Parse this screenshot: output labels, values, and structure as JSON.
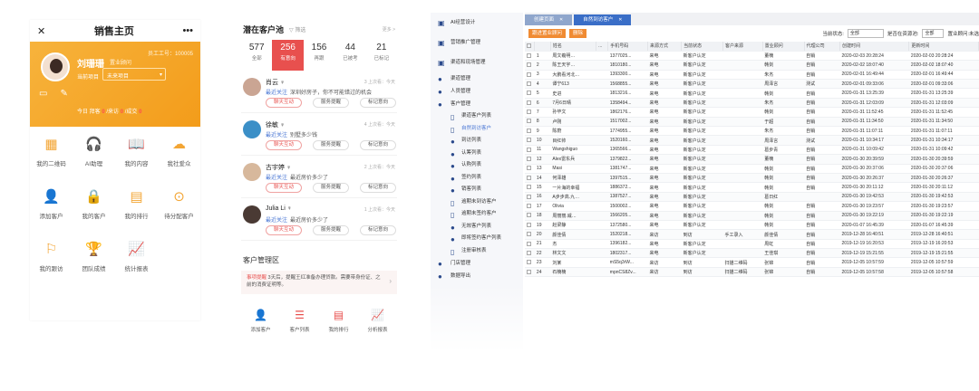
{
  "mobile_home": {
    "close_icon": "close-icon",
    "title": "销售主页",
    "more": "•••",
    "user_name": "刘珊珊",
    "user_role": "置业顾问",
    "emp_no": "员工工号：100005",
    "project_label": "当前项目",
    "project_value": "未来项目",
    "today_prefix": "今日 拜客",
    "today_count_1": "0",
    "today_mid": "/来访",
    "today_count_2": "0",
    "today_suffix": "/成交",
    "today_count_3": "0",
    "menu": [
      {
        "label": "我的二维码",
        "icon": "▦"
      },
      {
        "label": "AI助理",
        "icon": "🎧"
      },
      {
        "label": "我的内容",
        "icon": "📖"
      },
      {
        "label": "我社爱众",
        "icon": "☁"
      },
      {
        "label": "添加客户",
        "icon": "👤"
      },
      {
        "label": "我的客户",
        "icon": "🔒"
      },
      {
        "label": "我的排行",
        "icon": "▤"
      },
      {
        "label": "待分配客户",
        "icon": "⊙"
      },
      {
        "label": "我的跟访",
        "icon": "⚐"
      },
      {
        "label": "团队成绩",
        "icon": "🏆"
      },
      {
        "label": "统计报表",
        "icon": "📈"
      }
    ]
  },
  "pool": {
    "title": "潜在客户池",
    "filter": "筛选",
    "more": "更多 >",
    "stats": [
      {
        "n": "577",
        "l": "全部"
      },
      {
        "n": "256",
        "l": "有意向"
      },
      {
        "n": "156",
        "l": "再跟"
      },
      {
        "n": "44",
        "l": "已被考"
      },
      {
        "n": "21",
        "l": "已标记"
      }
    ],
    "customers": [
      {
        "name": "肖云 ♀",
        "time": "3 上次看：今天",
        "recent": "最近关注",
        "msg": "深圳好房子，你不可能错过的机会",
        "b1": "聊天互动",
        "b2": "服务提醒",
        "b3": "标记意向"
      },
      {
        "name": "徐敏 ♀",
        "time": "4 上次看：今天",
        "recent": "最近关注",
        "msg": "别墅多少钱",
        "b1": "聊天互动",
        "b2": "服务提醒",
        "b3": "标记意向"
      },
      {
        "name": "古宇婷 ♀",
        "time": "2 上次看：今天",
        "recent": "最近关注",
        "msg": "最近房价多少了",
        "b1": "聊天互动",
        "b2": "服务提醒",
        "b3": "标记意向"
      },
      {
        "name": "Julia Li ♀",
        "time": "1 上次看：今天",
        "recent": "最近关注",
        "msg": "最近房价多少了",
        "b1": "聊天互动",
        "b2": "服务提醒",
        "b3": "标记意向"
      }
    ],
    "mgmt_title": "客户管理区",
    "notice_hl": "事项提醒",
    "notice_text": " 3天后，提醒王红准备办理贷款。需要带身份证、之前的消费证明等。",
    "tools": [
      {
        "label": "添加客户",
        "icon": "👤"
      },
      {
        "label": "客户列表",
        "icon": "☰"
      },
      {
        "label": "我的排行",
        "icon": "▤"
      },
      {
        "label": "分析报表",
        "icon": "📈"
      }
    ]
  },
  "crm": {
    "sidebar": [
      {
        "label": "AI经营设计",
        "type": "top",
        "icon": "▣"
      },
      {
        "label": "营销推广管理",
        "type": "top",
        "icon": "▣"
      },
      {
        "label": "渠道和现场管理",
        "type": "top",
        "icon": "▣"
      },
      {
        "label": "渠道管理",
        "type": "item",
        "icon": "●"
      },
      {
        "label": "人员管理",
        "type": "item",
        "icon": "●"
      },
      {
        "label": "客户管理",
        "type": "item",
        "icon": "●"
      },
      {
        "label": "渠道客户列表",
        "type": "sub",
        "icon": "▯"
      },
      {
        "label": "自然到访客户",
        "type": "sub",
        "icon": "▯",
        "active": true
      },
      {
        "label": "到访列表",
        "type": "sub",
        "icon": "●"
      },
      {
        "label": "认筹列表",
        "type": "sub",
        "icon": "●"
      },
      {
        "label": "认购列表",
        "type": "sub",
        "icon": "●"
      },
      {
        "label": "签约列表",
        "type": "sub",
        "icon": "●"
      },
      {
        "label": "销客列表",
        "type": "sub",
        "icon": "●"
      },
      {
        "label": "逾期未到访客户",
        "type": "sub",
        "icon": "▯"
      },
      {
        "label": "逾期未签约客户",
        "type": "sub",
        "icon": "▯"
      },
      {
        "label": "无效客户列表",
        "type": "sub",
        "icon": "●"
      },
      {
        "label": "即将签约客户列表",
        "type": "sub",
        "icon": "●"
      },
      {
        "label": "注册审核表",
        "type": "sub",
        "icon": "▯"
      },
      {
        "label": "门店管理",
        "type": "item",
        "icon": "●"
      },
      {
        "label": "数据导出",
        "type": "item",
        "icon": "●"
      }
    ],
    "tabs": [
      {
        "label": "创建页面",
        "active": false
      },
      {
        "label": "自然到访客户",
        "active": true
      }
    ],
    "buttons": [
      "跟进置业顾问",
      "删除"
    ],
    "filters": {
      "status_label": "当前状态:",
      "status_value": "全部",
      "assigned_label": "是否在资源池:",
      "assigned_value": "全部",
      "adviser_label": "置业顾问:",
      "adviser_value": "未选"
    },
    "columns": [
      "",
      "",
      "姓名",
      "...",
      "手机号码",
      "来源方式",
      "当前状态",
      "客户来源",
      "置业顾问",
      "代理公司",
      "创建时间",
      "更新时间"
    ],
    "rows": [
      [
        "1",
        "周文羲明…",
        "1377025...",
        "来电",
        "新客户认定",
        "",
        "董楠",
        "自销",
        "2020-02-03 20:28:24",
        "2020-02-03 20:28:24"
      ],
      [
        "2",
        "陈王天宇…",
        "1810180...",
        "来电",
        "新客户认定",
        "",
        "韩剑",
        "自销",
        "2020-02-02 18:07:40",
        "2020-02-02 18:07:40"
      ],
      [
        "3",
        "大鹏看河北…",
        "1393300...",
        "来电",
        "新客户认定",
        "",
        "朱杰",
        "自销",
        "2020-02-01 16:49:44",
        "2020-02-01 16:49:44"
      ],
      [
        "4",
        "谭宁613",
        "1568855...",
        "来电",
        "新客户认定",
        "",
        "周泽言",
        "测试",
        "2020-02-01 09:33:06",
        "2020-02-01 09:33:06"
      ],
      [
        "5",
        "史进",
        "1813216...",
        "来电",
        "新客户认定",
        "",
        "韩剑",
        "自销",
        "2020-01-31 13:25:39",
        "2020-01-31 13:25:39"
      ],
      [
        "6",
        "7月6日晴",
        "1358494...",
        "来电",
        "新客户认定",
        "",
        "朱杰",
        "自销",
        "2020-01-31 12:03:09",
        "2020-01-31 12:03:09"
      ],
      [
        "7",
        "孙毕文",
        "1862176...",
        "来电",
        "新客户认定",
        "",
        "韩剑",
        "自销",
        "2020-01-31 11:52:45",
        "2020-01-31 11:52:45"
      ],
      [
        "8",
        "卢刚",
        "1517002...",
        "来电",
        "新客户认定",
        "",
        "于超",
        "自销",
        "2020-01-31 11:34:50",
        "2020-01-31 11:34:50"
      ],
      [
        "9",
        "陈蔚",
        "1774955...",
        "来电",
        "新客户认定",
        "",
        "朱杰",
        "自销",
        "2020-01-31 11:07:11",
        "2020-01-31 11:07:11"
      ],
      [
        "10",
        "目红帅",
        "1520160...",
        "来电",
        "新客户认定",
        "",
        "周泽言",
        "测试",
        "2020-01-31 10:34:17",
        "2020-01-31 10:34:17"
      ],
      [
        "11",
        "Wangshiguo",
        "1365566...",
        "来电",
        "新客户认定",
        "",
        "葛步青",
        "自销",
        "2020-01-31 10:09:42",
        "2020-01-31 10:09:42"
      ],
      [
        "12",
        "Alex雷东兵",
        "1379822...",
        "来电",
        "新客户认定",
        "",
        "董楠",
        "自销",
        "2020-01-30 20:39:59",
        "2020-01-30 20:39:59"
      ],
      [
        "13",
        "Masi",
        "1381747...",
        "来电",
        "新客户认定",
        "",
        "韩剑",
        "自销",
        "2020-01-30 20:37:06",
        "2020-01-30 20:37:06"
      ],
      [
        "14",
        "何泽雄",
        "1397515...",
        "来电",
        "新客户认定",
        "",
        "韩剑",
        "自销",
        "2020-01-30 20:26:37",
        "2020-01-30 20:26:37"
      ],
      [
        "15",
        "一片海的幸福",
        "1886372...",
        "来电",
        "新客户认定",
        "",
        "韩剑",
        "自销",
        "2020-01-30 20:11:12",
        "2020-01-30 20:11:12"
      ],
      [
        "16",
        "A步步高.九…",
        "1387527...",
        "来电",
        "新客户认定",
        "",
        "葛日红",
        "",
        "2020-01-30 19:42:53",
        "2020-01-30 19:42:53"
      ],
      [
        "17",
        "Olivia",
        "1500002...",
        "来电",
        "新客户认定",
        "",
        "韩剑",
        "自销",
        "2020-01-30 19:23:57",
        "2020-01-30 19:23:57"
      ],
      [
        "18",
        "周丽丽.威…",
        "1566205...",
        "来电",
        "新客户认定",
        "",
        "韩剑",
        "自销",
        "2020-01-30 19:22:19",
        "2020-01-30 19:22:19"
      ],
      [
        "19",
        "赵梁静",
        "1372580...",
        "来电",
        "新客户认定",
        "",
        "韩剑",
        "自销",
        "2020-01-07 16:45:39",
        "2020-01-07 16:45:39"
      ],
      [
        "20",
        "颜佳倩",
        "1520218...",
        "来访",
        "到访",
        "手工录入",
        "颜佳倩",
        "自销",
        "2019-12-28 16:40:51",
        "2019-12-28 16:40:51"
      ],
      [
        "21",
        "杰",
        "1396182...",
        "来电",
        "新客户认定",
        "",
        "周虹",
        "自销",
        "2019-12-19 16:20:53",
        "2019-12-19 16:20:53"
      ],
      [
        "22",
        "林文文",
        "1802317...",
        "来电",
        "新客户认定",
        "",
        "王佳琪",
        "自销",
        "2019-12-19 15:21:55",
        "2019-12-19 15:21:55"
      ],
      [
        "23",
        "刘某",
        "mS5q3rW...",
        "来访",
        "到访",
        "扫描二维码",
        "张锦",
        "自销",
        "2019-12-05 10:57:59",
        "2019-12-05 10:57:59"
      ],
      [
        "24",
        "石楠楠",
        "mpnCS8Zv...",
        "来访",
        "到访",
        "扫描二维码",
        "张锦",
        "自销",
        "2019-12-05 10:57:58",
        "2019-12-05 10:57:58"
      ]
    ]
  }
}
